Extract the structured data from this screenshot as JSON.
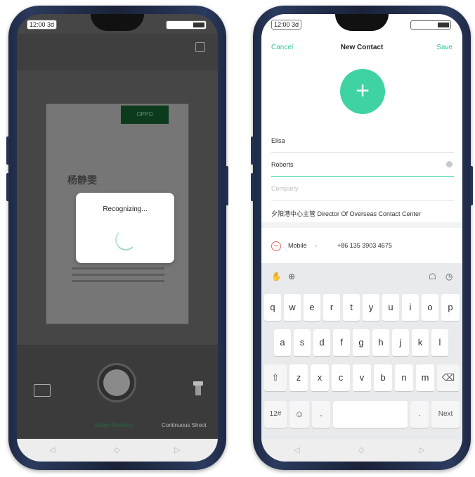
{
  "left": {
    "status_time": "12:00 3d",
    "frame_tag": "OPPO",
    "card_name": "杨静雯",
    "dialog_title": "Recognizing...",
    "mode_single": "Single Shooting",
    "mode_continuous": "Continuous Shoot",
    "nav_back": "◁",
    "nav_home": "◇",
    "nav_recent": "▷"
  },
  "right": {
    "status_time": "12:00 3d",
    "header": {
      "cancel": "Cancel",
      "title": "New Contact",
      "save": "Save"
    },
    "add_icon": "+",
    "fields": {
      "first_name": "Elisa",
      "last_name": "Roberts",
      "company_placeholder": "Company",
      "job_title": "夕阳港中心主管 Director Of Overseas Contact Center"
    },
    "phone": {
      "type": "Mobile",
      "arrow": "›",
      "number": "+86 135 3903 4675"
    },
    "keyboard": {
      "row1": [
        "q",
        "w",
        "e",
        "r",
        "t",
        "y",
        "u",
        "i",
        "o",
        "p"
      ],
      "row2": [
        "a",
        "s",
        "d",
        "f",
        "g",
        "h",
        "j",
        "k",
        "l"
      ],
      "row3": [
        "z",
        "x",
        "c",
        "v",
        "b",
        "n",
        "m"
      ],
      "shift": "⇧",
      "backspace": "⌫",
      "symbols": "12#",
      "emoji": "☺",
      "comma": ",",
      "period": ".",
      "next": "Next"
    },
    "nav_back": "◁",
    "nav_home": "◇",
    "nav_recent": "▷"
  },
  "colors": {
    "accent": "#3fd3a3",
    "accent_text": "#35c49a",
    "danger": "#e46a6a"
  }
}
